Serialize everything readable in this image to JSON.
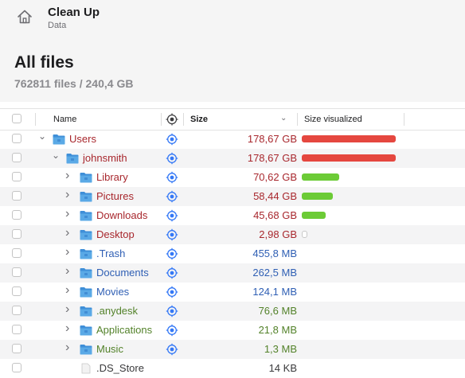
{
  "app": {
    "title": "Clean Up",
    "subtitle": "Data"
  },
  "page": {
    "title": "All files",
    "summary": "762811 files / 240,4 GB"
  },
  "columns": {
    "name": "Name",
    "size": "Size",
    "size_visualized": "Size visualized"
  },
  "colors": {
    "bar_red": "#e5473f",
    "bar_green": "#6ccb36",
    "folder_blue": "#5aa9e6",
    "target_blue": "#3478f6"
  },
  "rows": [
    {
      "name": "Users",
      "size": "178,67 GB",
      "size_fraction": 1.0,
      "bar_color": "red",
      "indent": 0,
      "expanded": true,
      "icon": "folder-users-icon",
      "text_color": "red"
    },
    {
      "name": "johnsmith",
      "size": "178,67 GB",
      "size_fraction": 1.0,
      "bar_color": "red",
      "indent": 1,
      "expanded": true,
      "icon": "folder-home-icon",
      "text_color": "red"
    },
    {
      "name": "Library",
      "size": "70,62 GB",
      "size_fraction": 0.395,
      "bar_color": "green",
      "indent": 2,
      "expanded": false,
      "icon": "folder-library-icon",
      "text_color": "red"
    },
    {
      "name": "Pictures",
      "size": "58,44 GB",
      "size_fraction": 0.327,
      "bar_color": "green",
      "indent": 2,
      "expanded": false,
      "icon": "folder-pictures-icon",
      "text_color": "red"
    },
    {
      "name": "Downloads",
      "size": "45,68 GB",
      "size_fraction": 0.256,
      "bar_color": "green",
      "indent": 2,
      "expanded": false,
      "icon": "folder-downloads-icon",
      "text_color": "red"
    },
    {
      "name": "Desktop",
      "size": "2,98 GB",
      "size_fraction": 0.017,
      "bar_color": "none",
      "indent": 2,
      "expanded": false,
      "icon": "folder-desktop-icon",
      "text_color": "red"
    },
    {
      "name": ".Trash",
      "size": "455,8 MB",
      "size_fraction": 0,
      "bar_color": "none",
      "indent": 2,
      "expanded": false,
      "icon": "folder-trash-icon",
      "text_color": "blue"
    },
    {
      "name": "Documents",
      "size": "262,5 MB",
      "size_fraction": 0,
      "bar_color": "none",
      "indent": 2,
      "expanded": false,
      "icon": "folder-documents-icon",
      "text_color": "blue"
    },
    {
      "name": "Movies",
      "size": "124,1 MB",
      "size_fraction": 0,
      "bar_color": "none",
      "indent": 2,
      "expanded": false,
      "icon": "folder-movies-icon",
      "text_color": "blue"
    },
    {
      "name": ".anydesk",
      "size": "76,6 MB",
      "size_fraction": 0,
      "bar_color": "none",
      "indent": 2,
      "expanded": false,
      "icon": "folder-anydesk-icon",
      "text_color": "green"
    },
    {
      "name": "Applications",
      "size": "21,8 MB",
      "size_fraction": 0,
      "bar_color": "none",
      "indent": 2,
      "expanded": false,
      "icon": "folder-applications-icon",
      "text_color": "green"
    },
    {
      "name": "Music",
      "size": "1,3 MB",
      "size_fraction": 0,
      "bar_color": "none",
      "indent": 2,
      "expanded": false,
      "icon": "folder-music-icon",
      "text_color": "green"
    },
    {
      "name": ".DS_Store",
      "size": "14 KB",
      "size_fraction": 0,
      "bar_color": "none",
      "indent": 2,
      "expanded": null,
      "icon": "file-icon",
      "text_color": "gray"
    }
  ]
}
